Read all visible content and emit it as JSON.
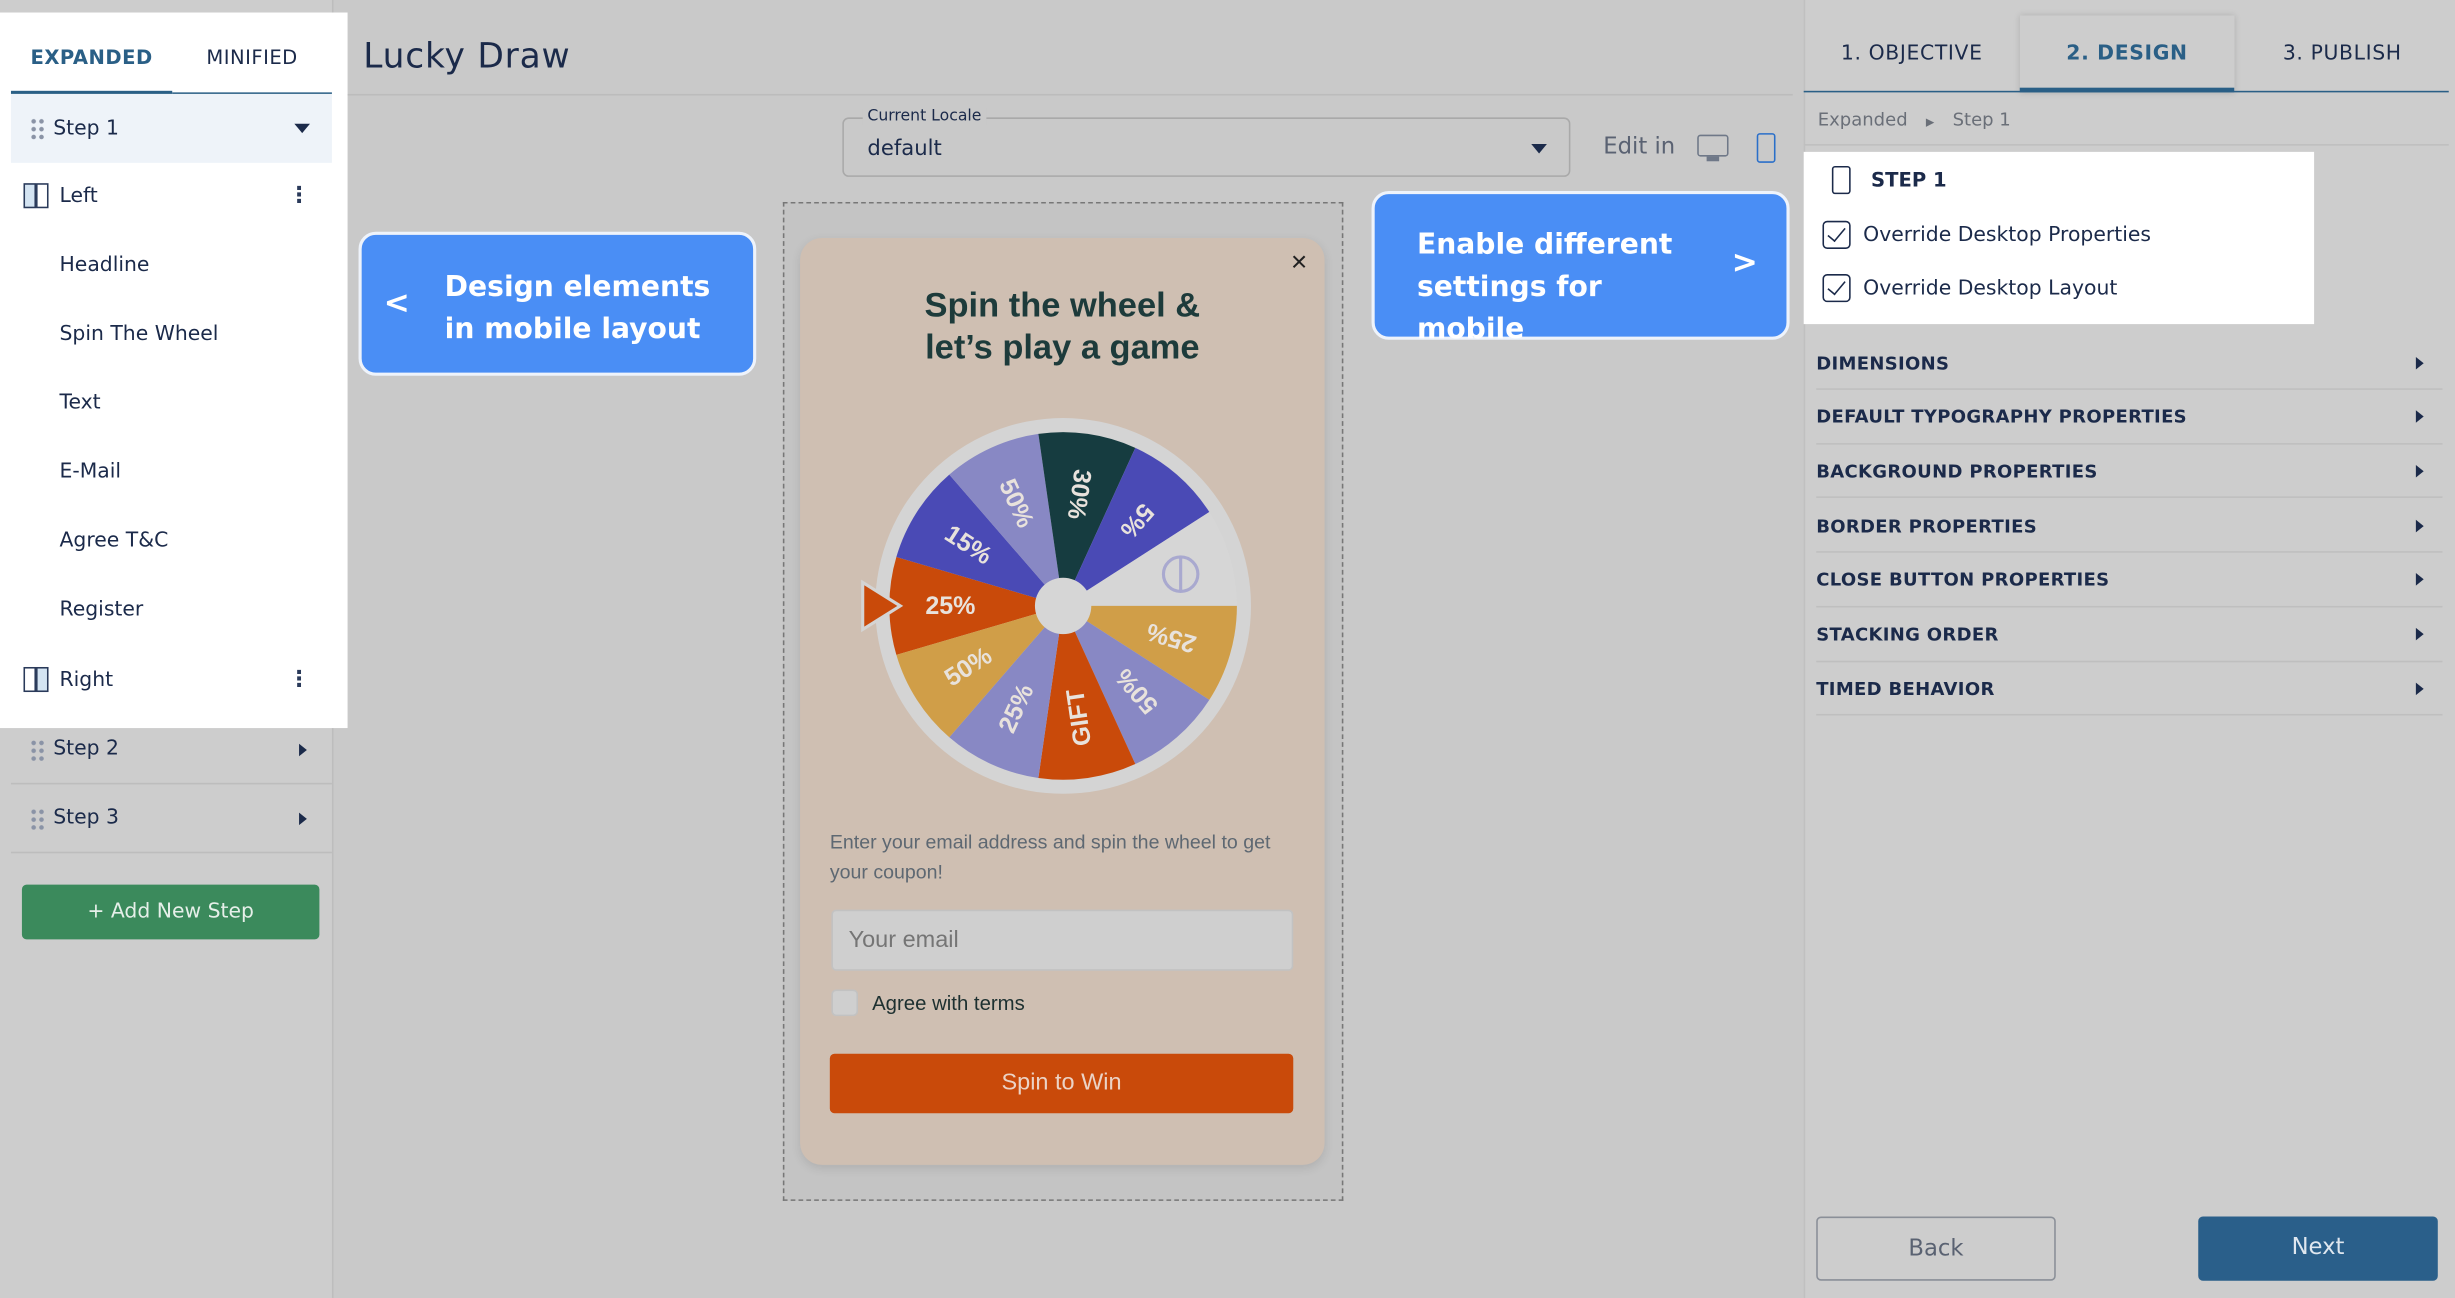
{
  "sidebar": {
    "tabs": [
      {
        "label": "EXPANDED",
        "active": true
      },
      {
        "label": "MINIFIED",
        "active": false
      }
    ],
    "steps": [
      {
        "label": "Step 1",
        "expanded": true,
        "children": [
          {
            "label": "Left",
            "type": "column",
            "children": [
              "Headline",
              "Spin The Wheel",
              "Text",
              "E-Mail",
              "Agree T&C",
              "Register"
            ]
          },
          {
            "label": "Right",
            "type": "column"
          }
        ]
      },
      {
        "label": "Step 2",
        "expanded": false
      },
      {
        "label": "Step 3",
        "expanded": false
      }
    ],
    "add_step_label": "+ Add New Step"
  },
  "main": {
    "title": "Lucky Draw",
    "locale": {
      "label": "Current Locale",
      "value": "default"
    },
    "edit_in_label": "Edit in",
    "edit_mode": "mobile"
  },
  "callouts": {
    "left": {
      "arrow": "<",
      "text": "Design elements in mobile layout"
    },
    "right": {
      "arrow": ">",
      "text": "Enable different settings for mobile"
    }
  },
  "popup": {
    "close": "×",
    "headline_1": "Spin the wheel &",
    "headline_2": "let’s play a game",
    "description": "Enter your email address and spin the wheel to get your coupon!",
    "email_placeholder": "Your email",
    "agree_label": "Agree with terms",
    "agree_checked": false,
    "button_label": "Spin to Win",
    "button_color": "#c94a0a",
    "wheel": {
      "segments": [
        {
          "label": "25%",
          "color": "#c94a0a"
        },
        {
          "label": "15%",
          "color": "#4a4ab5"
        },
        {
          "label": "50%",
          "color": "#8888c4"
        },
        {
          "label": "30%",
          "color": "#163c40"
        },
        {
          "label": "5%",
          "color": "#4a4ab5"
        },
        {
          "label": "",
          "color": "#d6d6d6",
          "icon": "no-prize-icon"
        },
        {
          "label": "25%",
          "color": "#d09e48"
        },
        {
          "label": "50%",
          "color": "#8888c4"
        },
        {
          "label": "GIFT",
          "color": "#c94a0a"
        },
        {
          "label": "25%",
          "color": "#8888c4"
        },
        {
          "label": "50%",
          "color": "#d09e48"
        }
      ]
    }
  },
  "right": {
    "tabs": [
      {
        "label": "1. OBJECTIVE",
        "active": false
      },
      {
        "label": "2. DESIGN",
        "active": true
      },
      {
        "label": "3. PUBLISH",
        "active": false
      }
    ],
    "breadcrumb": [
      "Expanded",
      "Step 1"
    ],
    "step_title": "STEP 1",
    "checkboxes": [
      {
        "label": "Override Desktop Properties",
        "checked": true
      },
      {
        "label": "Override Desktop Layout",
        "checked": true
      }
    ],
    "sections": [
      "DIMENSIONS",
      "DEFAULT TYPOGRAPHY PROPERTIES",
      "BACKGROUND PROPERTIES",
      "BORDER PROPERTIES",
      "CLOSE BUTTON PROPERTIES",
      "STACKING ORDER",
      "TIMED BEHAVIOR"
    ],
    "back_label": "Back",
    "next_label": "Next"
  },
  "colors": {
    "accent": "#2a5f86",
    "callout": "#4a8ef5",
    "add_step": "#3b8a5c"
  }
}
